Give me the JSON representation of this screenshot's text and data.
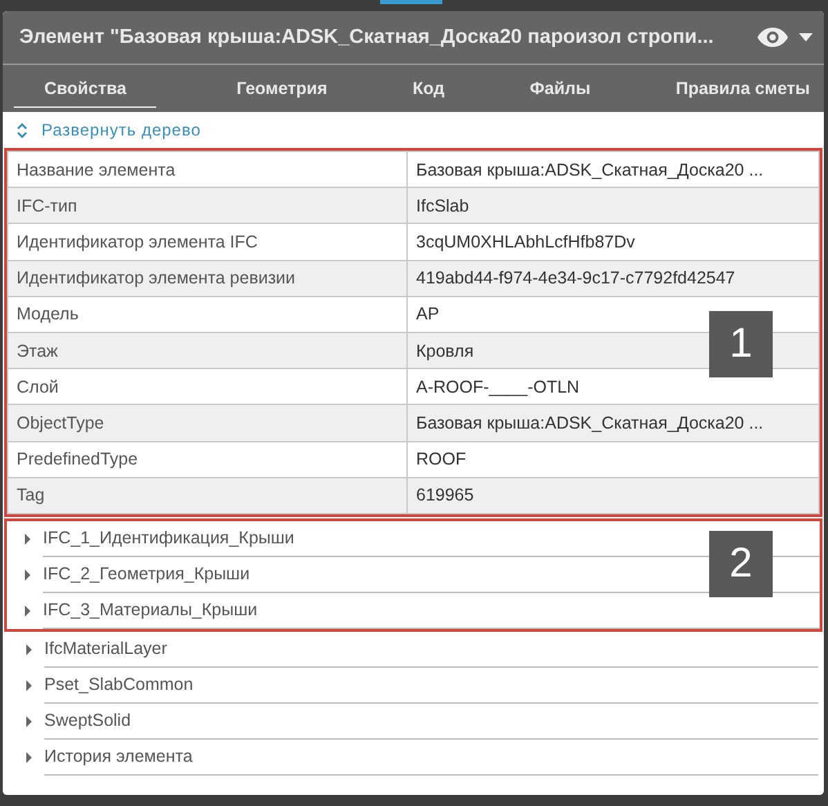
{
  "header": {
    "title": "Элемент \"Базовая крыша:ADSK_Скатная_Доска20 пароизол стропи..."
  },
  "tabs": [
    {
      "label": "Свойства",
      "selected": true
    },
    {
      "label": "Геометрия",
      "selected": false
    },
    {
      "label": "Код",
      "selected": false
    },
    {
      "label": "Файлы",
      "selected": false
    },
    {
      "label": "Правила сметы",
      "selected": false
    }
  ],
  "expand_link": "Развернуть дерево",
  "properties": [
    {
      "name": "Название элемента",
      "value": "Базовая крыша:ADSK_Скатная_Доска20 ..."
    },
    {
      "name": "IFC-тип",
      "value": "IfcSlab"
    },
    {
      "name": "Идентификатор элемента IFC",
      "value": "3cqUM0XHLAbhLcfHfb87Dv"
    },
    {
      "name": "Идентификатор элемента ревизии",
      "value": "419abd44-f974-4e34-9c17-c7792fd42547"
    },
    {
      "name": "Модель",
      "value": "AP"
    },
    {
      "name": "Этаж",
      "value": "Кровля"
    },
    {
      "name": "Слой",
      "value": "A-ROOF-____-OTLN"
    },
    {
      "name": "ObjectType",
      "value": "Базовая крыша:ADSK_Скатная_Доска20 ..."
    },
    {
      "name": "PredefinedType",
      "value": "ROOF"
    },
    {
      "name": "Tag",
      "value": "619965"
    }
  ],
  "highlighted_groups": [
    {
      "label": "IFC_1_Идентификация_Крыши",
      "expanded": false
    },
    {
      "label": "IFC_2_Геометрия_Крыши",
      "expanded": false
    },
    {
      "label": "IFC_3_Материалы_Крыши",
      "expanded": false
    }
  ],
  "groups": [
    {
      "label": "IfcMaterialLayer",
      "expanded": false
    },
    {
      "label": "Pset_SlabCommon",
      "expanded": false
    },
    {
      "label": "SweptSolid",
      "expanded": false
    },
    {
      "label": "История элемента",
      "expanded": false
    }
  ],
  "callouts": [
    "1",
    "2"
  ]
}
